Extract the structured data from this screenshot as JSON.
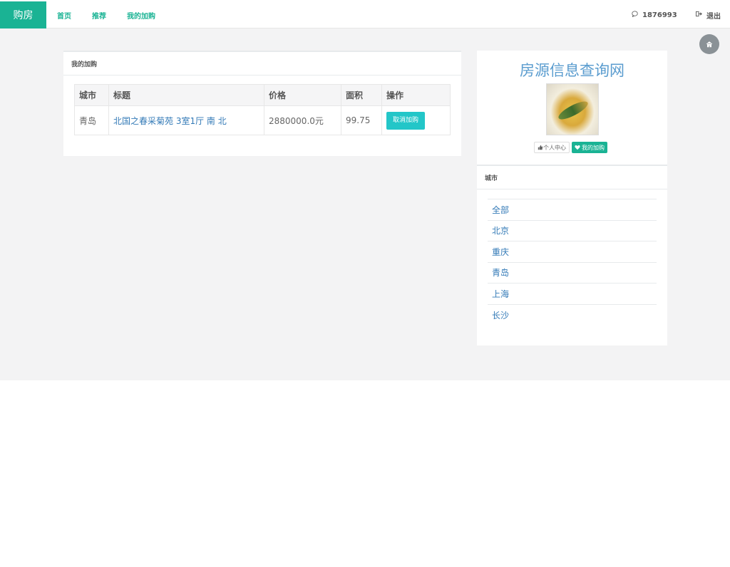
{
  "nav": {
    "brand": "购房",
    "links": [
      "首页",
      "推荐",
      "我的加购"
    ],
    "user_count": "1876993",
    "logout": "退出"
  },
  "cart_panel": {
    "title": "我的加购",
    "columns": [
      "城市",
      "标题",
      "价格",
      "面积",
      "操作"
    ],
    "rows": [
      {
        "city": "青岛",
        "title": "北国之春采菊苑 3室1厅 南 北",
        "price": "2880000.0元",
        "area": "99.75",
        "action": "取消加购"
      }
    ]
  },
  "profile_panel": {
    "site_title": "房源信息查询网",
    "profile_button": "个人中心",
    "cart_button": "我的加购"
  },
  "city_panel": {
    "title": "城市",
    "cities": [
      "全部",
      "北京",
      "重庆",
      "青岛",
      "上海",
      "长沙"
    ]
  },
  "colors": {
    "brand": "#1ab394",
    "link": "#337ab7",
    "action_button": "#23c6c8",
    "site_title": "#5a9ccf"
  },
  "icons": {
    "user_icon": "chat-bubble-icon",
    "logout_icon": "sign-out-icon",
    "home_icon": "home-icon"
  }
}
